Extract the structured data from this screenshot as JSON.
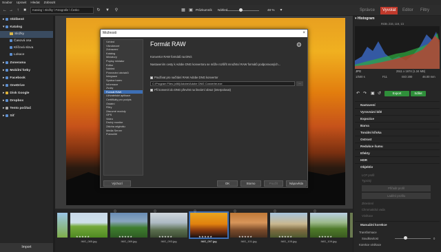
{
  "menubar": {
    "items": [
      "Soubor",
      "Upravit",
      "Hledat",
      "Zobrazit"
    ]
  },
  "toolbar": {
    "path": "Katalog \\ Složky \\ Fotografie \\ Česko",
    "view_mode": "Průzkumník",
    "preview_label": "Náhled",
    "zoom": "48 %",
    "zoom_level": 0.48,
    "tabs": [
      "Správce",
      "Vyvolat",
      "Editor",
      "Filtry"
    ]
  },
  "sidebar": {
    "items": [
      {
        "label": "Oblíbené"
      },
      {
        "label": "Katalog"
      },
      {
        "label": "Složky"
      },
      {
        "label": "Časová osa"
      },
      {
        "label": "Klíčová slova"
      },
      {
        "label": "Lokace"
      },
      {
        "label": "Zonerama"
      },
      {
        "label": "Mobilní fotky"
      },
      {
        "label": "Facebook"
      },
      {
        "label": "OneDrive"
      },
      {
        "label": "Disk Google"
      },
      {
        "label": "Dropbox"
      },
      {
        "label": "Tento počítač"
      },
      {
        "label": "Síť"
      }
    ],
    "import_label": "Import"
  },
  "dialog": {
    "title": "Možnosti",
    "heading": "Formát RAW",
    "options": [
      "Vzhled",
      "Všeobecné",
      "Zobrazení",
      "Katalog",
      "Miniatury",
      "Popisy miniatur",
      "Editor",
      "Náhled",
      "Porovnání obrázků",
      "Integrace",
      "Správa barev",
      "Informace",
      "Zvuky",
      "Formát RAW",
      "Uživatelské aplikace",
      "Certifikáty pro podpis",
      "Ostatní",
      "Filtry",
      "Zásuvné moduly",
      "GPS",
      "Video",
      "Druhý monitor",
      "Záloha originálu",
      "Media Server",
      "Pokročilé"
    ],
    "selected_option": "Formát RAW",
    "line1": "Konvertor RAW formátů na DNG",
    "line2": "Nastavením cesty k Adobe DNG konvertoru se může rozšířit množství RAW formátů podporovaných...",
    "checkbox1": "Používat pro načítání RAW Adobe DNG konvertor",
    "dng_path": "C:\\Program Files (x86)\\Adobe\\Adobe DNG Converter.exe",
    "browse": "...",
    "checkbox2": "Při konverzi do DNG převést na lineární obraz (interpolovat)",
    "btn_default": "Výchozí",
    "btn_ok": "OK",
    "btn_cancel": "Storno",
    "btn_apply": "Použít",
    "btn_help": "Nápověda"
  },
  "filmstrip": {
    "items": [
      {
        "name": "IMG_085.jpg"
      },
      {
        "name": "IMG_089.jpg"
      },
      {
        "name": "IMG_093.jpg"
      },
      {
        "name": "IMG_097.jpg"
      },
      {
        "name": "IMG_101.jpg"
      },
      {
        "name": "IMG_105.jpg"
      },
      {
        "name": "IMG_109.jpg"
      }
    ]
  },
  "rpanel": {
    "histogram_label": "Histogram",
    "rgb": "RGB: 215, 119, 13",
    "format": "JPG",
    "dims": "2511 x 1674 (1.34 MB)",
    "shutter": "1/500 s",
    "aperture": "F11",
    "iso": "ISO 200",
    "focal": "46.00 mm",
    "export": "Export",
    "share": "Sdílet",
    "sections": [
      "Nastavení",
      "Vyrovnání bílé",
      "Expozice",
      "Barva",
      "Tonální křivka",
      "Ostrost",
      "Redukce šumu",
      "Efekty",
      "HDR",
      "Objektiv"
    ],
    "lens_profile": "LCP profil",
    "lens_sub": "Typický",
    "btn_find_profile": "Přiřadit profil",
    "btn_lens_detail": "Ladění profilu",
    "dim_items": [
      "Zkreslení",
      "Chromatická vada",
      "Vinětace"
    ],
    "section_manual": "Manuální korekce",
    "manual_sub": "Transformace",
    "slider_label": "Soudkovitost",
    "slider_value": "0",
    "slider_level": 0.5,
    "last_label": "Korekce vinětace"
  }
}
